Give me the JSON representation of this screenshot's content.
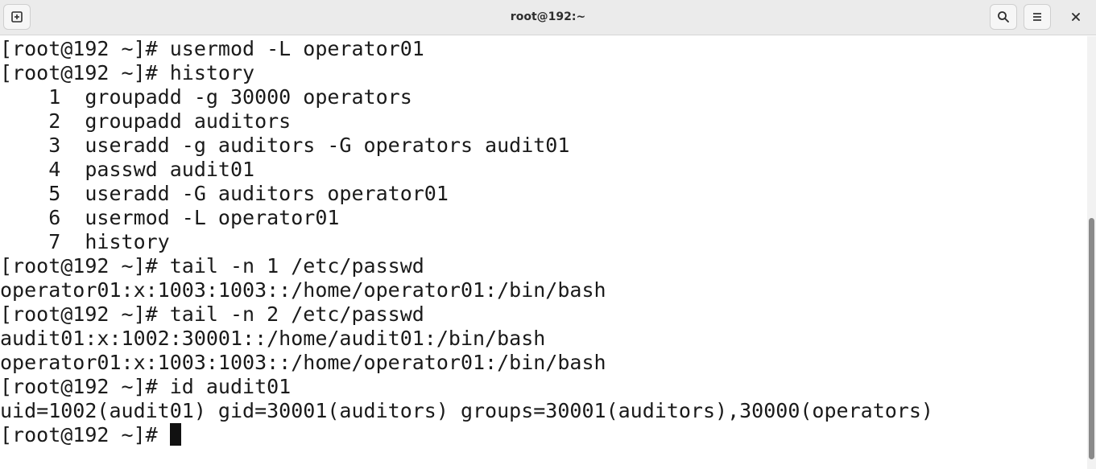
{
  "window": {
    "title": "root@192:~"
  },
  "icons": {
    "new_tab": "new-tab-icon",
    "search": "search-icon",
    "menu": "hamburger-menu-icon",
    "close": "close-icon"
  },
  "terminal": {
    "lines": [
      "[root@192 ~]# usermod -L operator01",
      "[root@192 ~]# history",
      "    1  groupadd -g 30000 operators",
      "    2  groupadd auditors",
      "    3  useradd -g auditors -G operators audit01",
      "    4  passwd audit01",
      "    5  useradd -G auditors operator01",
      "    6  usermod -L operator01",
      "    7  history",
      "[root@192 ~]# tail -n 1 /etc/passwd",
      "operator01:x:1003:1003::/home/operator01:/bin/bash",
      "[root@192 ~]# tail -n 2 /etc/passwd",
      "audit01:x:1002:30001::/home/audit01:/bin/bash",
      "operator01:x:1003:1003::/home/operator01:/bin/bash",
      "[root@192 ~]# id audit01",
      "uid=1002(audit01) gid=30001(auditors) groups=30001(auditors),30000(operators)"
    ],
    "prompt": "[root@192 ~]# "
  }
}
